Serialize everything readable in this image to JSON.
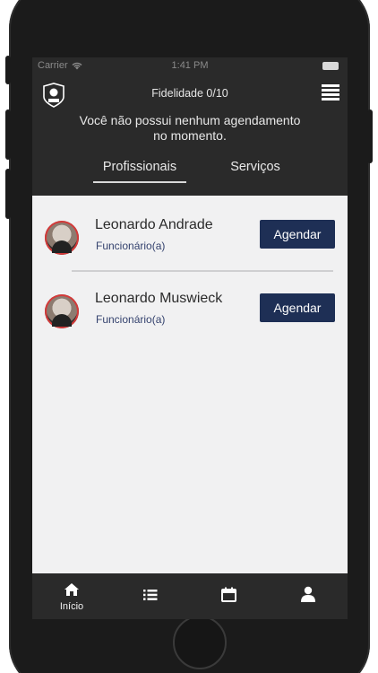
{
  "status_bar": {
    "carrier": "Carrier",
    "time": "1:41 PM"
  },
  "header": {
    "fidelity": "Fidelidade 0/10"
  },
  "notice": "Você não possui nenhum agendamento no momento.",
  "tabs": [
    {
      "label": "Profissionais",
      "active": true
    },
    {
      "label": "Serviços",
      "active": false
    }
  ],
  "professionals": [
    {
      "name": "Leonardo Andrade",
      "role": "Funcionário(a)",
      "button": "Agendar"
    },
    {
      "name": "Leonardo Muswieck",
      "role": "Funcionário(a)",
      "button": "Agendar"
    }
  ],
  "bottom_nav": [
    {
      "icon": "home-icon",
      "label": "Início"
    },
    {
      "icon": "list-icon",
      "label": ""
    },
    {
      "icon": "calendar-icon",
      "label": ""
    },
    {
      "icon": "user-icon",
      "label": ""
    }
  ],
  "colors": {
    "dark": "#2a2a2a",
    "button": "#1e2f55",
    "role_text": "#34426e",
    "background": "#f1f1f2"
  }
}
